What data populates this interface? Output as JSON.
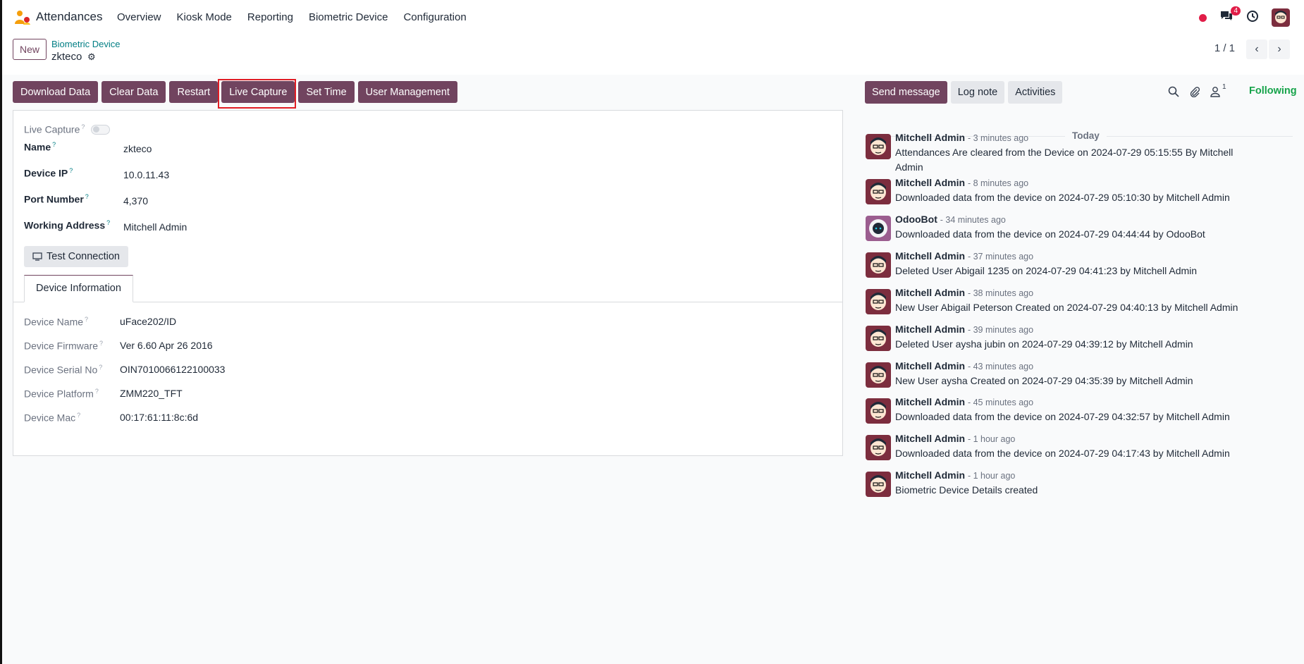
{
  "app": {
    "name": "Attendances"
  },
  "menu": [
    "Overview",
    "Kiosk Mode",
    "Reporting",
    "Biometric Device",
    "Configuration"
  ],
  "systray": {
    "message_count": "4"
  },
  "control_panel": {
    "new_label": "New",
    "breadcrumb_parent": "Biometric Device",
    "record_name": "zkteco",
    "pager": "1 / 1"
  },
  "actions": [
    "Download Data",
    "Clear Data",
    "Restart",
    "Live Capture",
    "Set Time",
    "User Management"
  ],
  "form": {
    "live_capture_label": "Live Capture",
    "fields": [
      {
        "label": "Name",
        "value": "zkteco"
      },
      {
        "label": "Device IP",
        "value": "10.0.11.43"
      },
      {
        "label": "Port Number",
        "value": "4,370"
      },
      {
        "label": "Working Address",
        "value": "Mitchell Admin"
      }
    ],
    "test_button": "Test Connection",
    "tab_label": "Device Information",
    "device_info": [
      {
        "label": "Device Name",
        "value": "uFace202/ID"
      },
      {
        "label": "Device Firmware",
        "value": "Ver 6.60 Apr 26 2016"
      },
      {
        "label": "Device Serial No",
        "value": "OIN7010066122100033"
      },
      {
        "label": "Device Platform",
        "value": "ZMM220_TFT"
      },
      {
        "label": "Device Mac",
        "value": "00:17:61:11:8c:6d"
      }
    ]
  },
  "chatter": {
    "send_message": "Send message",
    "log_note": "Log note",
    "activities": "Activities",
    "followers_count": "1",
    "following": "Following",
    "today": "Today",
    "messages": [
      {
        "author": "Mitchell Admin",
        "date": "- 3 minutes ago",
        "body": "Attendances Are cleared from the Device on 2024-07-29 05:15:55 By Mitchell Admin",
        "avatar": "admin"
      },
      {
        "author": "Mitchell Admin",
        "date": "- 8 minutes ago",
        "body": "Downloaded data from the device on 2024-07-29 05:10:30 by Mitchell Admin",
        "avatar": "admin"
      },
      {
        "author": "OdooBot",
        "date": "- 34 minutes ago",
        "body": "Downloaded data from the device on 2024-07-29 04:44:44 by OdooBot",
        "avatar": "bot"
      },
      {
        "author": "Mitchell Admin",
        "date": "- 37 minutes ago",
        "body": "Deleted User Abigail 1235 on 2024-07-29 04:41:23 by Mitchell Admin",
        "avatar": "admin"
      },
      {
        "author": "Mitchell Admin",
        "date": "- 38 minutes ago",
        "body": "New User Abigail Peterson Created on 2024-07-29 04:40:13 by Mitchell Admin",
        "avatar": "admin"
      },
      {
        "author": "Mitchell Admin",
        "date": "- 39 minutes ago",
        "body": "Deleted User aysha jubin on 2024-07-29 04:39:12 by Mitchell Admin",
        "avatar": "admin"
      },
      {
        "author": "Mitchell Admin",
        "date": "- 43 minutes ago",
        "body": "New User aysha Created on 2024-07-29 04:35:39 by Mitchell Admin",
        "avatar": "admin"
      },
      {
        "author": "Mitchell Admin",
        "date": "- 45 minutes ago",
        "body": "Downloaded data from the device on 2024-07-29 04:32:57 by Mitchell Admin",
        "avatar": "admin"
      },
      {
        "author": "Mitchell Admin",
        "date": "- 1 hour ago",
        "body": "Downloaded data from the device on 2024-07-29 04:17:43 by Mitchell Admin",
        "avatar": "admin"
      },
      {
        "author": "Mitchell Admin",
        "date": "- 1 hour ago",
        "body": "Biometric Device Details created",
        "avatar": "admin"
      }
    ]
  },
  "colors": {
    "primary": "#71445f",
    "link": "#017e84",
    "following": "#16a34a",
    "highlight": "#e11d24"
  }
}
